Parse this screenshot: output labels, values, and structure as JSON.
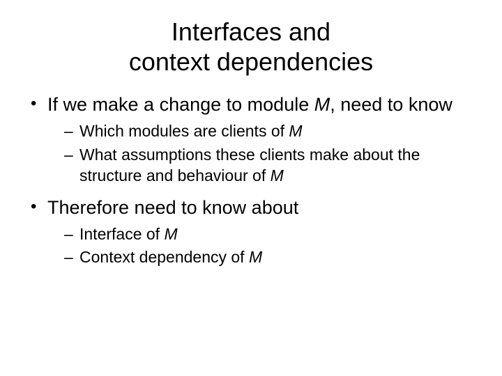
{
  "title_line1": "Interfaces and",
  "title_line2": "context dependencies",
  "bullets": [
    {
      "text_pre": "If we make a change to module ",
      "text_ital": "M",
      "text_post": ", need to know",
      "subs": [
        {
          "pre": "Which modules are clients of ",
          "ital": "M",
          "post": ""
        },
        {
          "pre": "What assumptions these clients make about the structure and behaviour of ",
          "ital": "M",
          "post": ""
        }
      ]
    },
    {
      "text_pre": "Therefore need to know about",
      "text_ital": "",
      "text_post": "",
      "subs": [
        {
          "pre": "Interface of ",
          "ital": "M",
          "post": ""
        },
        {
          "pre": "Context dependency of ",
          "ital": "M",
          "post": ""
        }
      ]
    }
  ]
}
